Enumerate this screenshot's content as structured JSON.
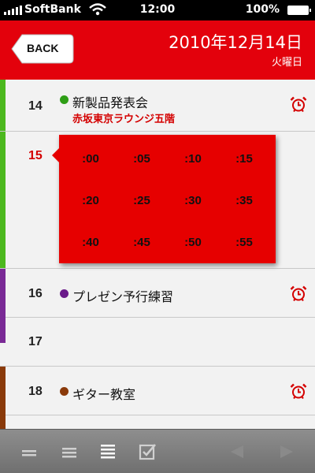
{
  "status_bar": {
    "carrier": "SoftBank",
    "time": "12:00",
    "battery": "100%"
  },
  "header": {
    "back_label": "BACK",
    "date": "2010年12月14日",
    "weekday": "火曜日",
    "background": "#e3010c"
  },
  "timeline": {
    "rows": [
      {
        "hour": "14",
        "title": "新製品発表会",
        "location": "赤坂東京ラウンジ五階",
        "dot_color": "#2e9e16",
        "bar_color": "#4cb81e",
        "alarm": true
      },
      {
        "hour": "15",
        "current": true,
        "bar_color": "#4cb81e"
      },
      {
        "hour": "16",
        "title": "プレゼン予行練習",
        "dot_color": "#6a1a8a",
        "bar_color": "#7a2a96",
        "alarm": true
      },
      {
        "hour": "17"
      },
      {
        "hour": "18",
        "title": "ギター教室",
        "dot_color": "#8a3a0a",
        "bar_color": "#8a3a0a",
        "alarm": true
      }
    ]
  },
  "minute_picker": {
    "minutes": [
      ":00",
      ":05",
      ":10",
      ":15",
      ":20",
      ":25",
      ":30",
      ":35",
      ":40",
      ":45",
      ":50",
      ":55"
    ]
  },
  "toolbar": {
    "icons": [
      "view-two-lines-icon",
      "view-three-lines-icon",
      "view-list-icon",
      "todo-checkbox-icon",
      "previous-icon",
      "next-icon"
    ],
    "selected": "view-list-icon"
  },
  "colors": {
    "accent": "#e3010c",
    "current_hour": "#d40000",
    "alarm": "#d40000"
  }
}
